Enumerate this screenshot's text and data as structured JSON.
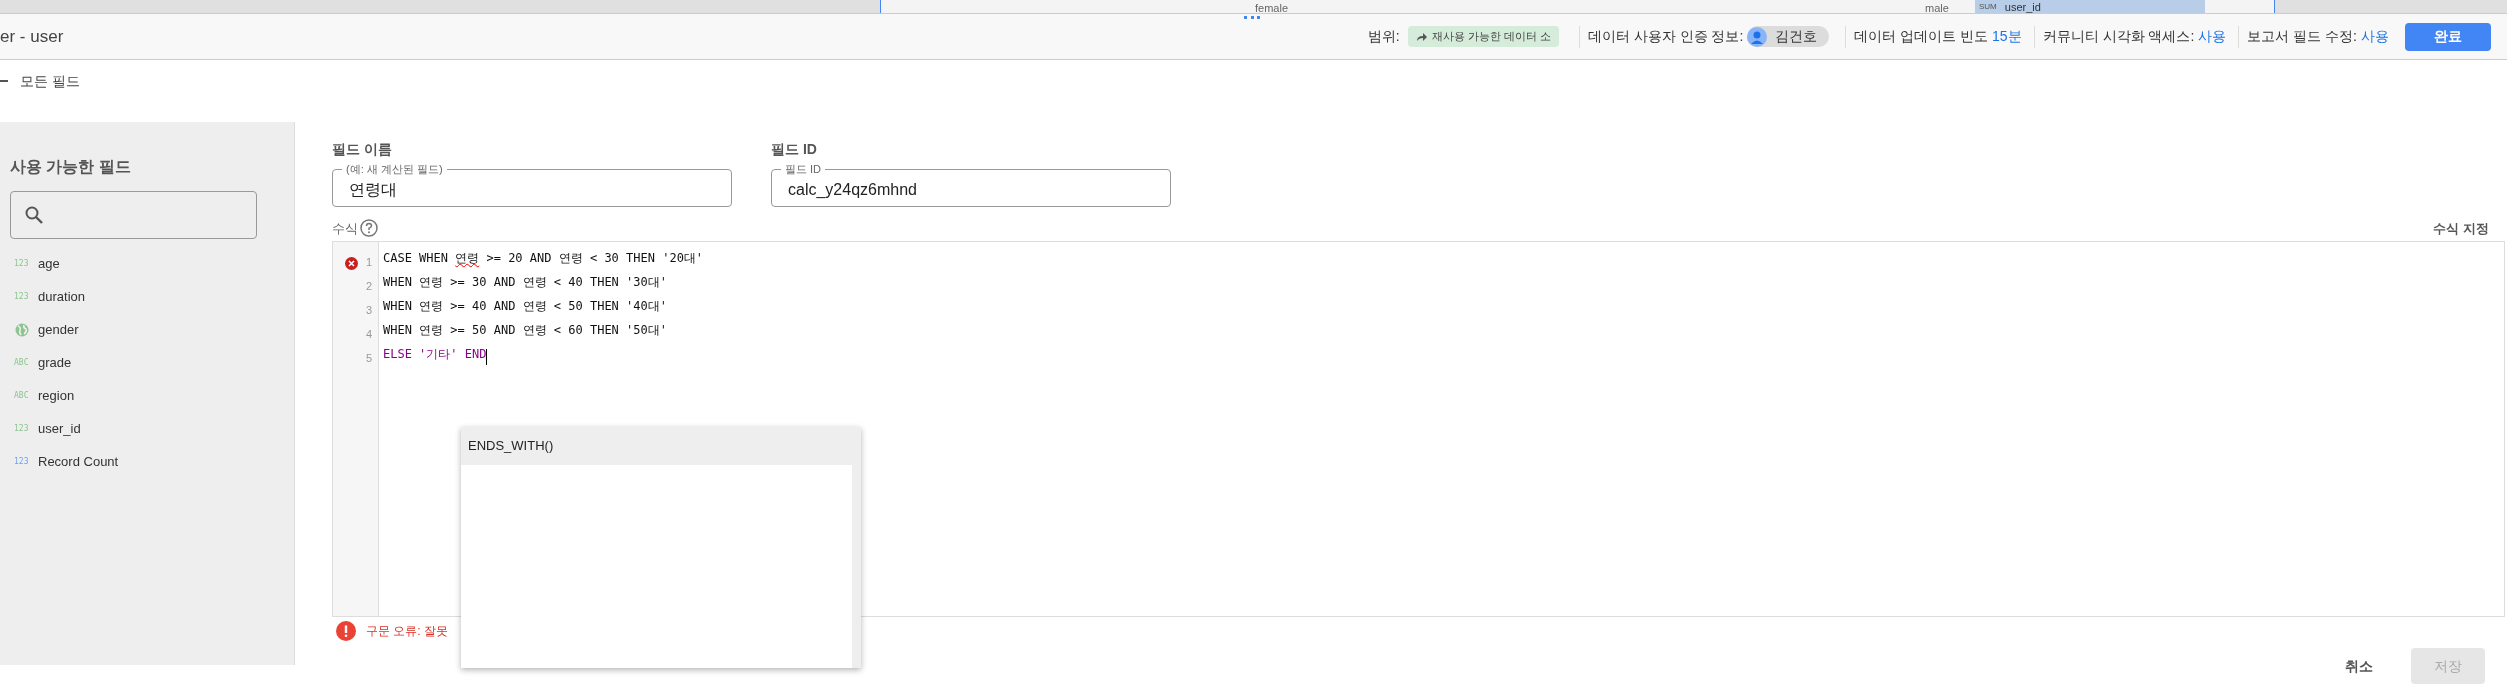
{
  "background_report": {
    "texts": [
      "female",
      "male"
    ],
    "metric_badge": "SUM",
    "metric_name": "user_id"
  },
  "header": {
    "title": "er - user",
    "scope_label": "범위:",
    "scope_chip": "재사용 가능한 데이터 소",
    "credentials_label": "데이터 사용자 인증 정보:",
    "credentials_user": "김건호",
    "freshness_label": "데이터 업데이트 빈도",
    "freshness_value": "15분",
    "community_label": "커뮤니티 시각화 액세스:",
    "community_value": "사용",
    "edit_label": "보고서 필드 수정:",
    "edit_value": "사용",
    "done_button": "완료"
  },
  "breadcrumb": "모든 필드",
  "sidebar": {
    "title": "사용 가능한 필드",
    "search": {
      "kind": "search"
    },
    "items": [
      {
        "kind": "badge",
        "badge": "123",
        "name": "age",
        "color": "#8bc58f"
      },
      {
        "kind": "badge",
        "badge": "123",
        "name": "duration",
        "color": "#8bc58f"
      },
      {
        "kind": "globe",
        "name": "gender",
        "color": "#8bc58f"
      },
      {
        "kind": "badge",
        "badge": "ABC",
        "name": "grade",
        "color": "#8bc58f"
      },
      {
        "kind": "badge",
        "badge": "ABC",
        "name": "region",
        "color": "#8bc58f"
      },
      {
        "kind": "badge",
        "badge": "123",
        "name": "user_id",
        "color": "#8bc58f"
      },
      {
        "kind": "badge",
        "badge": "123",
        "name": "Record Count",
        "color": "#6d9ff5"
      }
    ]
  },
  "field_name": {
    "label": "필드 이름",
    "floating_label": "(예: 새 계산된 필드)",
    "value": "연령대"
  },
  "field_id": {
    "label": "필드 ID",
    "floating_label": "필드 ID",
    "value": "calc_y24qz6mhnd"
  },
  "formula": {
    "label": "수식",
    "format_button": "수식 지정",
    "lines": [
      {
        "number": "1",
        "error": true,
        "color": "#111111",
        "segments": [
          {
            "text": "CASE WHEN ",
            "misspelled": false
          },
          {
            "text": "연령",
            "misspelled": true
          },
          {
            "text": " >= 20 AND 연령 < 30 THEN '20대'",
            "misspelled": false
          }
        ]
      },
      {
        "number": "2",
        "error": false,
        "color": "#111111",
        "segments": [
          {
            "text": "WHEN 연령 >= 30 AND 연령 < 40 THEN '30대'",
            "misspelled": false
          }
        ]
      },
      {
        "number": "3",
        "error": false,
        "color": "#111111",
        "segments": [
          {
            "text": "WHEN 연령 >= 40 AND 연령 < 50 THEN '40대'",
            "misspelled": false
          }
        ]
      },
      {
        "number": "4",
        "error": false,
        "color": "#111111",
        "segments": [
          {
            "text": "WHEN 연령 >= 50 AND 연령 < 60 THEN '50대'",
            "misspelled": false
          }
        ]
      },
      {
        "number": "5",
        "error": false,
        "color": "#8b008b",
        "cursor": true,
        "segments": [
          {
            "text": "ELSE '기타' END",
            "misspelled": false
          }
        ]
      }
    ],
    "autocomplete": [
      {
        "label": "ENDS_WITH()",
        "selected": true
      }
    ],
    "error_message": "구문 오류: 잘못"
  },
  "footer": {
    "cancel_button": "취소",
    "save_button": {
      "label": "저장",
      "disabled": true
    }
  }
}
